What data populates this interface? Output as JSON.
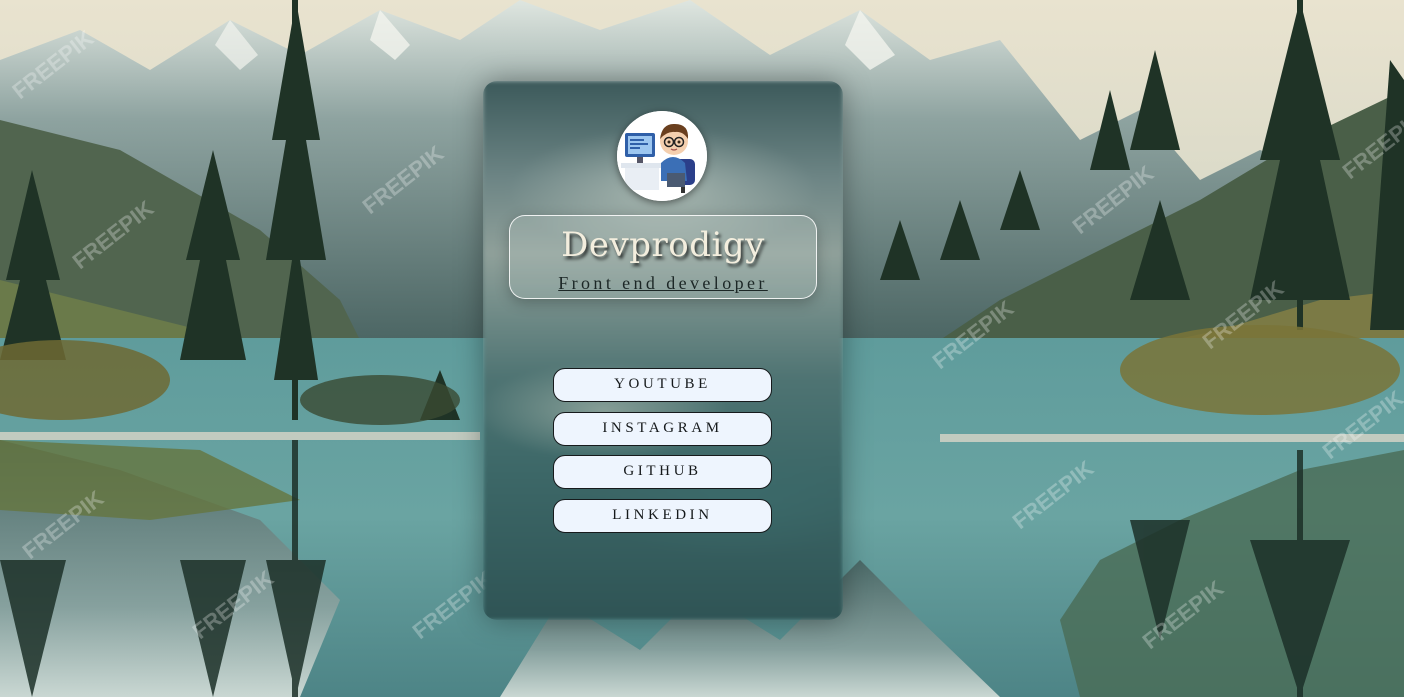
{
  "profile": {
    "name": "Devprodigy",
    "subtitle": "Front end developer",
    "avatar_icon": "developer-avatar-icon"
  },
  "links": [
    {
      "label": "YOUTUBE"
    },
    {
      "label": "INSTAGRAM"
    },
    {
      "label": "GITHUB"
    },
    {
      "label": "LINKEDIN"
    }
  ],
  "background": {
    "watermark_text": "FREEPIK"
  },
  "colors": {
    "button_bg": "#eef5fe",
    "button_border": "#161a1c",
    "title_color": "#f3eede",
    "card_tone": "#4f7473"
  }
}
